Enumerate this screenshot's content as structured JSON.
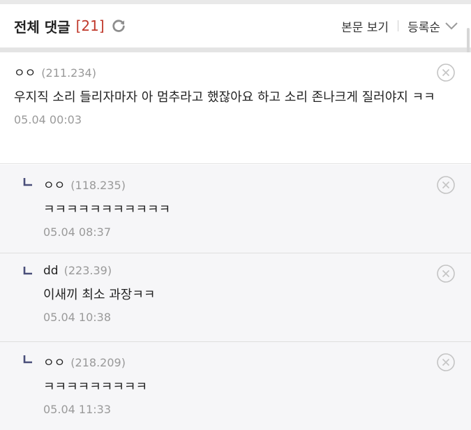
{
  "header": {
    "title": "전체 댓글",
    "count": "[21]",
    "view_body_label": "본문 보기",
    "sort_label": "등록순"
  },
  "colors": {
    "count": "#c0392b",
    "reply_bg": "#f6f6f8",
    "reply_arrow": "#4a4f7a"
  },
  "comments": [
    {
      "author": "ㅇㅇ",
      "ip": "(211.234)",
      "text": "우지직 소리 들리자마자 아 멈추라고 했잖아요 하고 소리 존나크게 질러야지 ㅋㅋ",
      "time": "05.04 00:03",
      "reply": false
    },
    {
      "author": "ㅇㅇ",
      "ip": "(118.235)",
      "text": "ㅋㅋㅋㅋㅋㅋㅋㅋㅋㅋㅋ",
      "time": "05.04 08:37",
      "reply": true
    },
    {
      "author": "dd",
      "ip": "(223.39)",
      "text": "이새끼 최소 과장ㅋㅋ",
      "time": "05.04 10:38",
      "reply": true
    },
    {
      "author": "ㅇㅇ",
      "ip": "(218.209)",
      "text": "ㅋㅋㅋㅋㅋㅋㅋㅋㅋ",
      "time": "05.04 11:33",
      "reply": true
    }
  ]
}
